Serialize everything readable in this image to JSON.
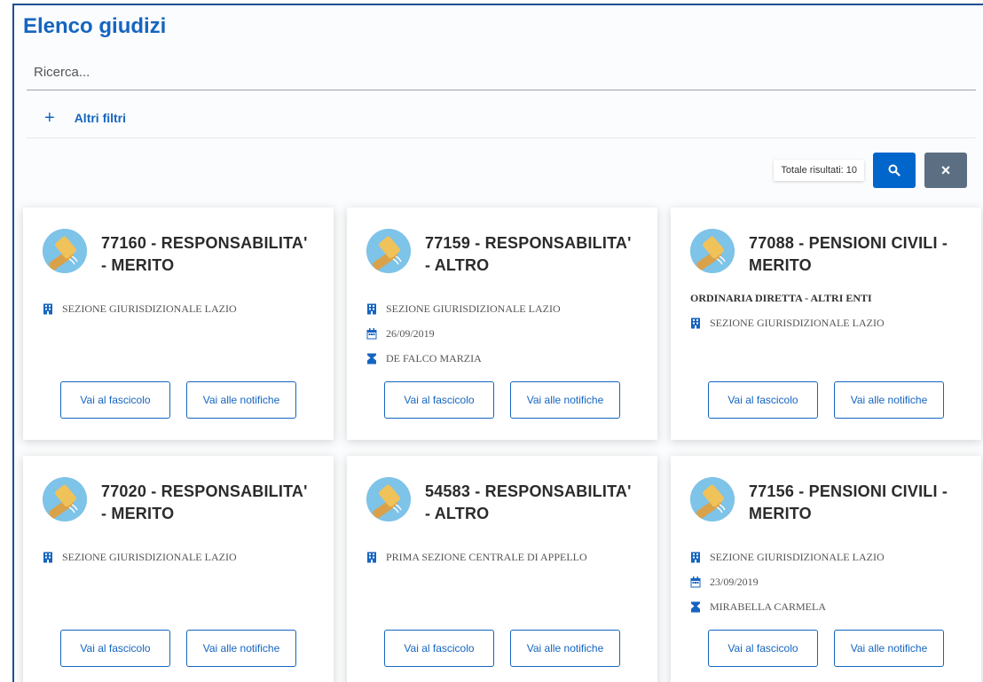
{
  "page_title": "Elenco giudizi",
  "search": {
    "placeholder": "Ricerca..."
  },
  "filters": {
    "label": "Altri filtri"
  },
  "results": {
    "total_label": "Totale risultati: 10"
  },
  "icons": {
    "search_button": "search-icon",
    "clear_button": "close-icon",
    "building": "building-icon",
    "calendar": "calendar-icon",
    "person": "person-icon"
  },
  "colors": {
    "accent": "#0066cc",
    "title": "#1565c0",
    "clear_button": "#5c6f82"
  },
  "card_buttons": {
    "fascicolo": "Vai al fascicolo",
    "notifiche": "Vai alle notifiche"
  },
  "cards": [
    {
      "title": "77160 - RESPONSABILITA' - MERITO",
      "subtype": "",
      "sezione": "SEZIONE GIURISDIZIONALE LAZIO",
      "date": "",
      "person": ""
    },
    {
      "title": "77159 - RESPONSABILITA' - ALTRO",
      "subtype": "",
      "sezione": "SEZIONE GIURISDIZIONALE LAZIO",
      "date": "26/09/2019",
      "person": "DE FALCO MARZIA"
    },
    {
      "title": "77088 - PENSIONI CIVILI - MERITO",
      "subtype": "ORDINARIA DIRETTA - ALTRI ENTI",
      "sezione": "SEZIONE GIURISDIZIONALE LAZIO",
      "date": "",
      "person": ""
    },
    {
      "title": "77020 - RESPONSABILITA' - MERITO",
      "subtype": "",
      "sezione": "SEZIONE GIURISDIZIONALE LAZIO",
      "date": "",
      "person": ""
    },
    {
      "title": "54583 - RESPONSABILITA' - ALTRO",
      "subtype": "",
      "sezione": "PRIMA SEZIONE CENTRALE DI APPELLO",
      "date": "",
      "person": ""
    },
    {
      "title": "77156 - PENSIONI CIVILI - MERITO",
      "subtype": "",
      "sezione": "SEZIONE GIURISDIZIONALE LAZIO",
      "date": "23/09/2019",
      "person": "MIRABELLA CARMELA"
    }
  ]
}
